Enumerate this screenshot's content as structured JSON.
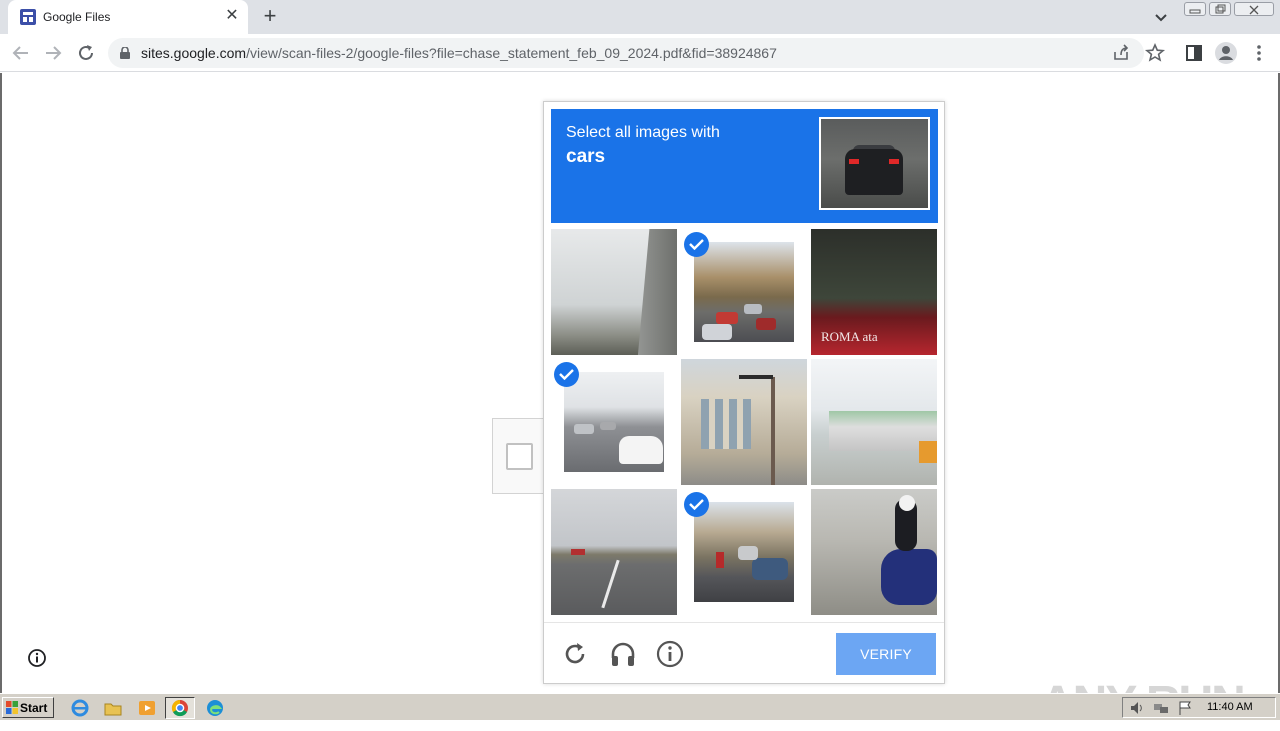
{
  "browser": {
    "tab_title": "Google Files",
    "url_host": "sites.google.com",
    "url_path": "/view/scan-files-2/google-files?file=chase_statement_feb_09_2024.pdf&fid=38924867"
  },
  "captcha": {
    "instruction": "Select all images with",
    "target": "cars",
    "tiles": [
      {
        "scene": "overpass-sky",
        "selected": false
      },
      {
        "scene": "street-traffic-cars",
        "selected": true
      },
      {
        "scene": "bus-window-roma",
        "selected": false
      },
      {
        "scene": "intersection-white-car",
        "selected": true
      },
      {
        "scene": "building-traffic-light",
        "selected": false
      },
      {
        "scene": "storefront-building",
        "selected": false
      },
      {
        "scene": "highway-road",
        "selected": false
      },
      {
        "scene": "street-parked-cars",
        "selected": true
      },
      {
        "scene": "motorcycle-rider",
        "selected": false
      }
    ],
    "verify_label": "VERIFY"
  },
  "watermark": "ANY RUN",
  "taskbar": {
    "start_label": "Start",
    "clock": "11:40 AM"
  },
  "colors": {
    "accent": "#1a73e8",
    "verify_button": "#6ca6f3"
  }
}
